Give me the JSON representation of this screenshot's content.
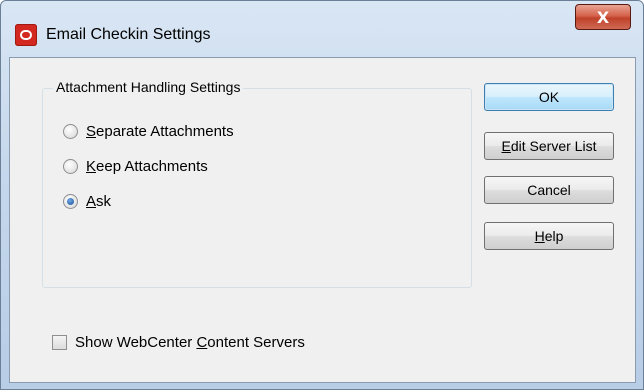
{
  "window": {
    "title": "Email Checkin Settings",
    "close_glyph": "X",
    "app_icon": "oracle-logo-icon"
  },
  "group": {
    "legend": "Attachment Handling Settings",
    "options": [
      {
        "pre": "",
        "mnemonic": "S",
        "post": "eparate Attachments",
        "checked": false
      },
      {
        "pre": "",
        "mnemonic": "K",
        "post": "eep Attachments",
        "checked": false
      },
      {
        "pre": "",
        "mnemonic": "A",
        "post": "sk",
        "checked": true
      }
    ]
  },
  "buttons": {
    "ok": {
      "pre": "OK",
      "mnemonic": "",
      "post": ""
    },
    "edit_server_list": {
      "pre": "",
      "mnemonic": "E",
      "post": "dit Server List"
    },
    "cancel": {
      "pre": "Cancel",
      "mnemonic": "",
      "post": ""
    },
    "help": {
      "pre": "",
      "mnemonic": "H",
      "post": "elp"
    }
  },
  "show_servers": {
    "pre": "Show WebCenter ",
    "mnemonic": "C",
    "post": "ontent Servers",
    "checked": false
  }
}
